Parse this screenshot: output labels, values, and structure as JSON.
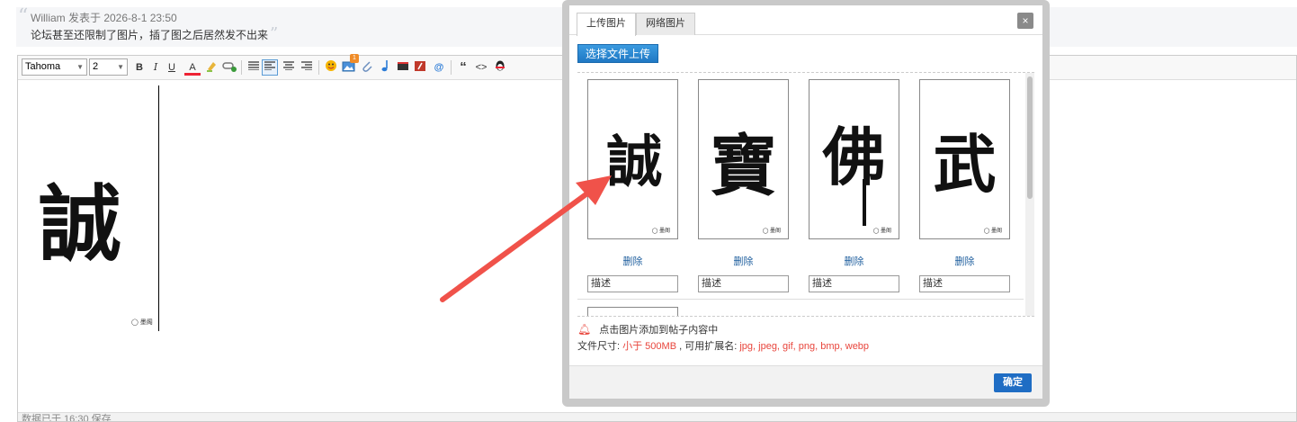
{
  "quote": {
    "author_line": "William 发表于 2026-8-1 23:50",
    "text": "论坛甚至还限制了图片，插了图之后居然发不出来"
  },
  "toolbar": {
    "font_family": "Tahoma",
    "font_size": "2",
    "bold": "B",
    "italic": "I",
    "underline": "U",
    "font_color": "A",
    "quote_glyph": "“",
    "code_glyph": "<>",
    "at_glyph": "@",
    "image_badge": "1"
  },
  "editor": {
    "image_glyph": "誠",
    "image_seal": "◯ 墨阁",
    "status_text": "数据已于 16:30 保存"
  },
  "dialog": {
    "tabs": [
      {
        "label": "上传图片",
        "active": true
      },
      {
        "label": "网络图片",
        "active": false
      }
    ],
    "close": "×",
    "upload_button": "选择文件上传",
    "images": [
      {
        "glyph": "誠",
        "seal": "◯ 墨阁",
        "delete_label": "删除",
        "desc_value": "描述"
      },
      {
        "glyph": "寶",
        "seal": "◯ 墨阁",
        "delete_label": "删除",
        "desc_value": "描述"
      },
      {
        "glyph": "佛",
        "seal": "◯ 墨阁",
        "delete_label": "删除",
        "desc_value": "描述"
      },
      {
        "glyph": "武",
        "seal": "◯ 墨阁",
        "delete_label": "删除",
        "desc_value": "描述"
      }
    ],
    "notice": "点击图片添加到帖子内容中",
    "file_size_label": "文件尺寸:",
    "file_size_value": "小于 500MB",
    "ext_label": ", 可用扩展名:",
    "ext_value": "jpg, jpeg, gif, png, bmp, webp",
    "ok_button": "确定"
  },
  "colors": {
    "accent_blue": "#1f6dc4",
    "warning_red": "#e8453c",
    "arrow_red": "#f0524a"
  }
}
